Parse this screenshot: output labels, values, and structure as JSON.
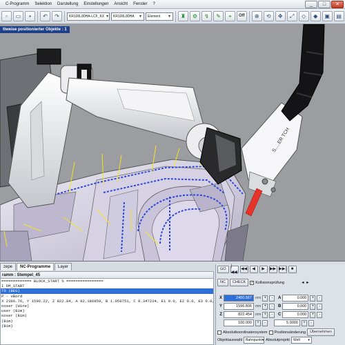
{
  "menubar": {
    "items": [
      "C-Programm",
      "Selektion",
      "Darstellung",
      "Einstellungen",
      "Ansicht",
      "Fenster",
      "?"
    ],
    "window_buttons": [
      "_",
      "□",
      "✕"
    ]
  },
  "toolbar": {
    "robot_combo_1": "KR100L80HA-LCF_KX",
    "robot_combo_2": "KR100L80HA",
    "element_combo": "Element",
    "off_label": "Off"
  },
  "viewport": {
    "banner": "ttweise positionierter Objekte : 1",
    "tool_head_text": "S.....ER TCH"
  },
  "tabs": {
    "items": [
      "zepe",
      "NC-Programme",
      "Layer"
    ],
    "active_index": 1
  },
  "program": {
    "header": "ramm : Stempel_45",
    "lines": [
      "============= BLOCK_START % ================",
      "I DM_START",
      "TO (BEG)",
      "P - vBord",
      "X 2386.76, Y 1596.22, Z 822.84, A 92.186859, B 1.058751, C 0.347224, E1 0.0, E2 0.0, E3 0.0, E4 0.0, E5 0.0",
      "ooser (Wine)",
      "user (Bim)",
      "ooser (Bim)",
      "(Bim)",
      "(Bim)",
      "",
      "",
      ""
    ],
    "selected_line_index": 2
  },
  "control": {
    "top_buttons": [
      "GO",
      "|◀◀",
      "◀◀",
      "◀",
      "▶",
      "▶▶",
      "▶▶|",
      "■"
    ],
    "nc_label": "NC",
    "check_label": "CHECK",
    "collision_label": "Kollisionsprüfung",
    "collision_checked": true,
    "arrow_hint": "◄  ►",
    "coords": [
      {
        "axis": "X",
        "value": "2400.567",
        "unit": "mm",
        "axis2": "A",
        "value2": "0.000"
      },
      {
        "axis": "Y",
        "value": "1596.806",
        "unit": "mm",
        "axis2": "B",
        "value2": "0.000"
      },
      {
        "axis": "Z",
        "value": "822.454",
        "unit": "mm",
        "axis2": "C",
        "value2": "0.000"
      }
    ],
    "step_value": "100.000",
    "step_value2": "5.0000",
    "absolute_label": "Absolutkoordinatensystem",
    "position_label": "Positionsänderung",
    "apply_label": "Übernehmen",
    "objektauswahl_label": "Objektauswahl",
    "bahnpunkt_label": "Bahnpunkt",
    "absolut_label": "Absolutprojekt",
    "welt_label": "Welt"
  },
  "colors": {
    "viewport_bg": "#9b9da1",
    "selection": "#2f6fd8",
    "banner": "#1f3f86",
    "path_blue": "#2f47d8",
    "path_yellow": "#f4e41f",
    "laser": "#e8332a"
  },
  "icons": [
    "new-file-icon",
    "open-folder-icon",
    "save-icon",
    "cut-icon",
    "copy-icon",
    "paste-icon",
    "undo-icon",
    "redo-icon",
    "robot-icon",
    "gripper-icon",
    "zoom-icon",
    "rotate-icon",
    "pan-icon",
    "fit-icon",
    "wireframe-icon",
    "shaded-icon"
  ]
}
